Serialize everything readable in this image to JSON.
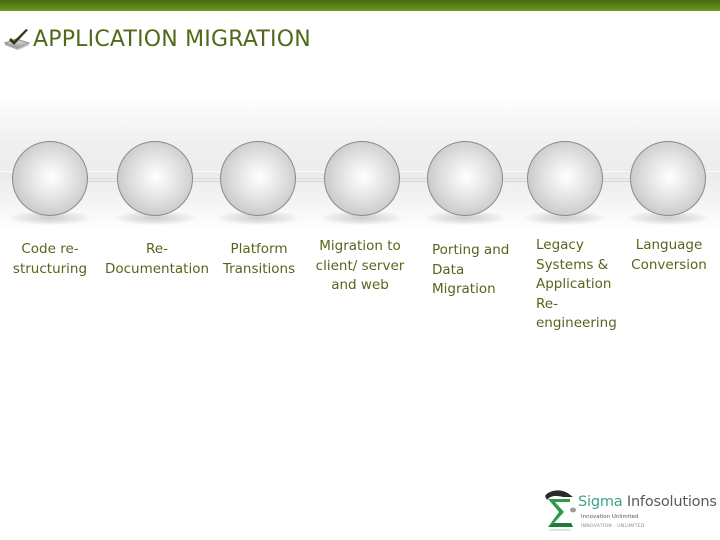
{
  "slide": {
    "title": "APPLICATION MIGRATION",
    "title_icon": "checkmark-checkbox-icon",
    "accent_color": "#5d8416",
    "text_color": "#55661c"
  },
  "steps": [
    {
      "label": "Code re-\nstructuring",
      "align": "center"
    },
    {
      "label": "Re-\nDocumentation",
      "align": "center"
    },
    {
      "label": "Platform\nTransitions",
      "align": "center"
    },
    {
      "label": "Migration to\nclient/ server\nand web",
      "align": "center"
    },
    {
      "label": "Porting and\nData\nMigration",
      "align": "left"
    },
    {
      "label": "Legacy\nSystems &\nApplication\nRe-\nengineering",
      "align": "left"
    },
    {
      "label": "Language\nConversion",
      "align": "center"
    }
  ],
  "logo": {
    "icon": "sigma-logo-icon",
    "name_part1": "Sigma",
    "name_part2": " Infosolutions",
    "tagline": "Innovation Unlimited",
    "subline": "INNOVATION · UNLIMITED"
  }
}
